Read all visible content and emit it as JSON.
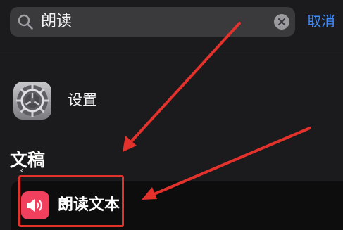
{
  "search": {
    "query": "朗读",
    "icon": "search-icon",
    "clear_icon": "clear-icon"
  },
  "header": {
    "cancel_label": "取消",
    "accent_color": "#3d8cff"
  },
  "results": {
    "app_item": {
      "label": "设置",
      "icon": "settings-gear-icon"
    },
    "section_title": "文稿",
    "action_item": {
      "label": "朗读文本",
      "icon": "speaker-icon",
      "icon_color": "#f0405e"
    }
  },
  "annotations": {
    "highlight_color": "#e3312c"
  }
}
